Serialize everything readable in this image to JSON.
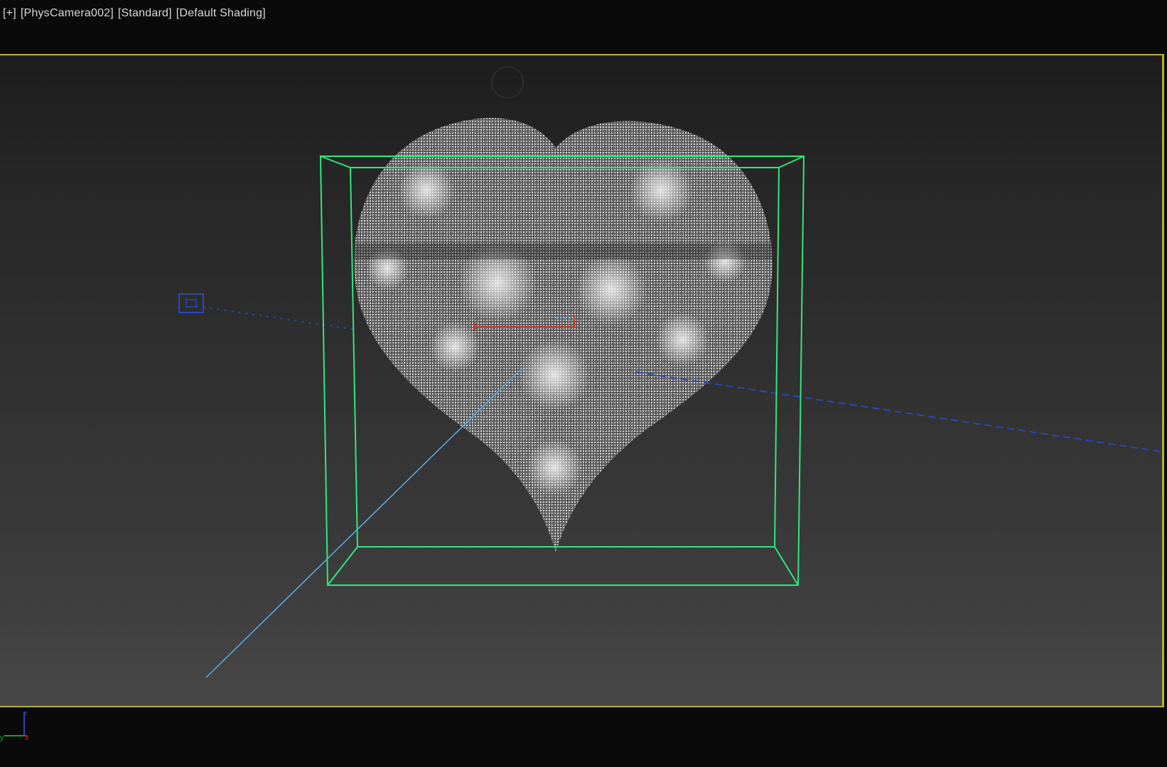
{
  "viewport": {
    "labels": [
      "[+]",
      "[PhysCamera002]",
      "[Standard]",
      "[Default Shading]"
    ],
    "active_border_color": "#b8b02a"
  },
  "scene": {
    "object_bounding_box_color": "#2fe87a",
    "camera_line_color": "#2b47b8",
    "target_line_color": "#5ab0ee",
    "selection_gizmo_color": "#c0392b",
    "object": "heart-shaped point cloud"
  },
  "axis_tripod": {
    "labels": [
      "z",
      "y",
      "x"
    ],
    "colors": [
      "#2b47b8",
      "#1f9d2a",
      "#d02020"
    ]
  },
  "icons": [
    "navigation-circle-icon",
    "camera-icon",
    "axis-tripod-icon"
  ]
}
